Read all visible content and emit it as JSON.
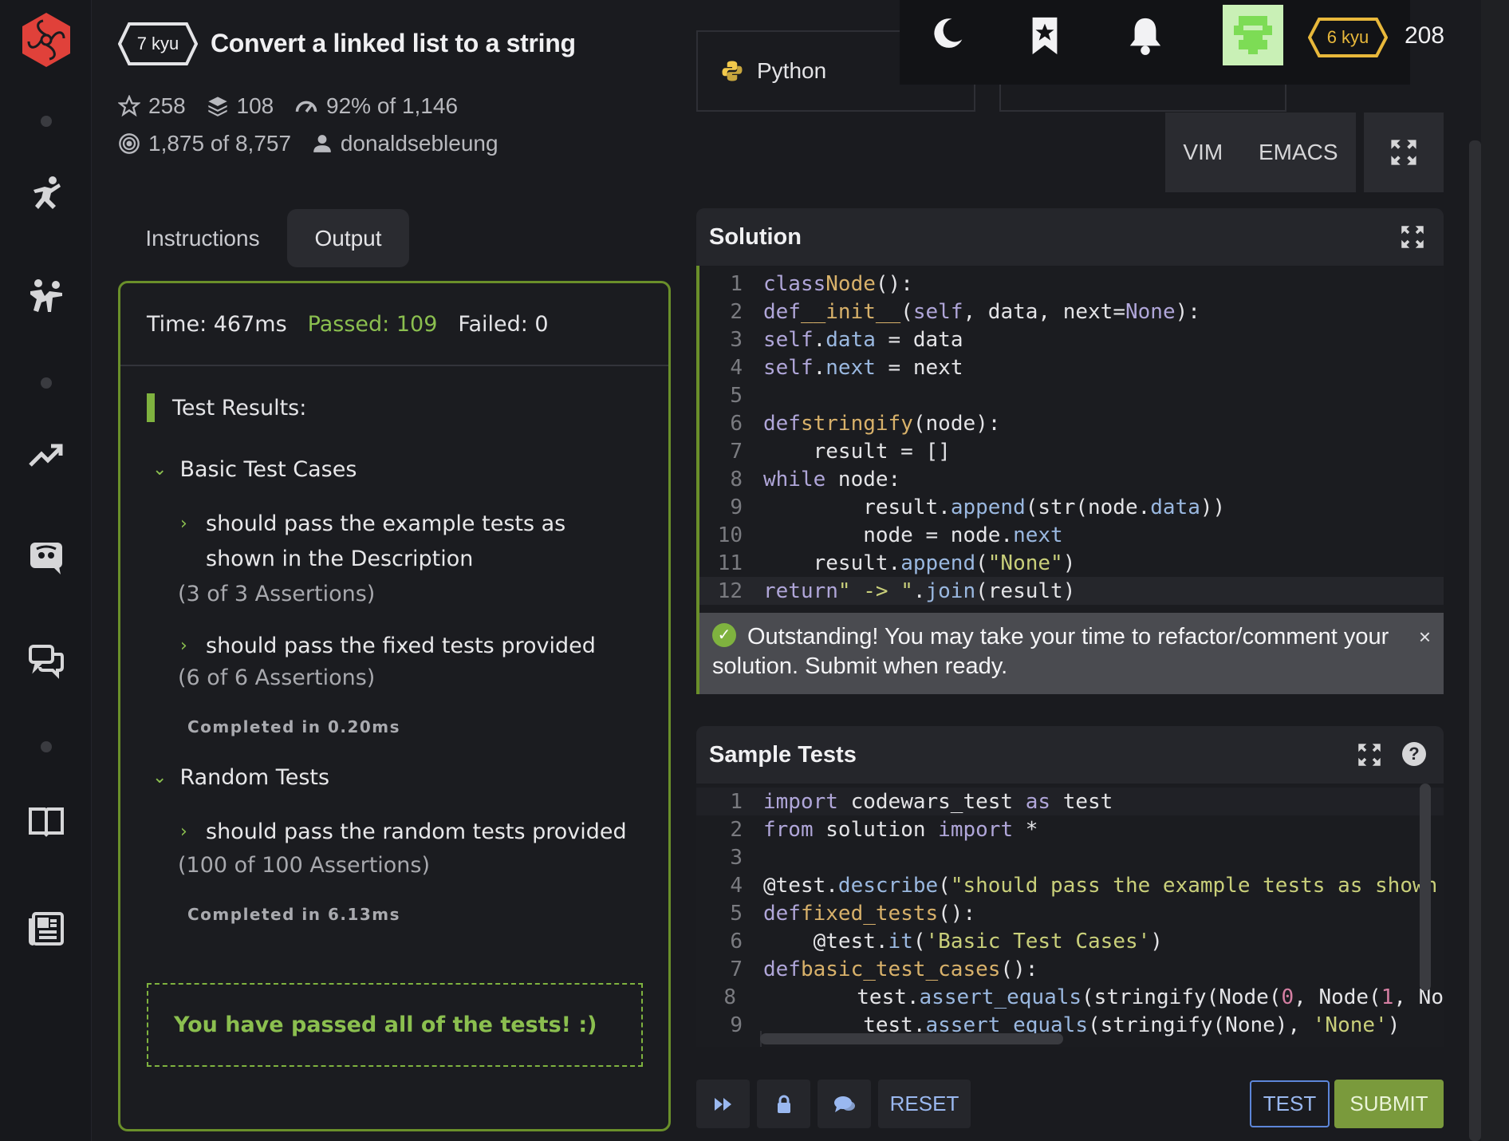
{
  "kata": {
    "kyu": "7 kyu",
    "title": "Convert a linked list to a string",
    "stars": "258",
    "collections": "108",
    "satisfaction": "92% of 1,146",
    "completed": "1,875 of 8,757",
    "author": "donaldsebleung"
  },
  "tabs": {
    "instructions": "Instructions",
    "output": "Output"
  },
  "output": {
    "time": "Time: 467ms",
    "passed": "Passed: 109",
    "failed": "Failed: 0",
    "heading": "Test Results:",
    "groups": [
      {
        "name": "Basic Test Cases",
        "cases": [
          {
            "text": "should pass the example tests as shown in the Description",
            "assertions": "(3 of 3 Assertions)"
          },
          {
            "text": "should pass the fixed tests provided",
            "assertions": "(6 of 6 Assertions)"
          }
        ],
        "completed": "Completed in 0.20ms"
      },
      {
        "name": "Random Tests",
        "cases": [
          {
            "text": "should pass the random tests provided",
            "assertions": "(100 of 100 Assertions)"
          }
        ],
        "completed": "Completed in 6.13ms"
      }
    ],
    "all_passed": "You have passed all of the tests! :)"
  },
  "language": "Python",
  "topbar": {
    "kyu": "6 kyu",
    "honor": "208"
  },
  "editor_modes": {
    "vim": "VIM",
    "emacs": "EMACS"
  },
  "solution": {
    "title": "Solution",
    "toast": "Outstanding! You may take your time to refactor/comment your solution. Submit when ready.",
    "toast_close": "×",
    "lines": [
      "1",
      "2",
      "3",
      "4",
      "5",
      "6",
      "7",
      "8",
      "9",
      "10",
      "11",
      "12"
    ]
  },
  "sample_tests": {
    "title": "Sample Tests",
    "help": "?",
    "lines": [
      "1",
      "2",
      "3",
      "4",
      "5",
      "6",
      "7",
      "8",
      "9"
    ]
  },
  "actions": {
    "reset": "RESET",
    "test": "TEST",
    "submit": "SUBMIT"
  },
  "colors": {
    "accent_green": "#7fb23f",
    "brand_red": "#e0413a",
    "rank_yellow": "#e8b83b",
    "link_blue": "#9ab8f0"
  },
  "icons": [
    "logo-icon",
    "training-icon",
    "practice-icon",
    "leaderboard-icon",
    "discord-icon",
    "discussion-icon",
    "docs-icon",
    "blog-icon",
    "star-icon",
    "collection-icon",
    "satisfaction-icon",
    "target-icon",
    "user-icon",
    "moon-icon",
    "bookmark-icon",
    "bell-icon",
    "fullscreen-icon",
    "check-icon",
    "run-icon",
    "lock-icon",
    "chat-icon"
  ]
}
